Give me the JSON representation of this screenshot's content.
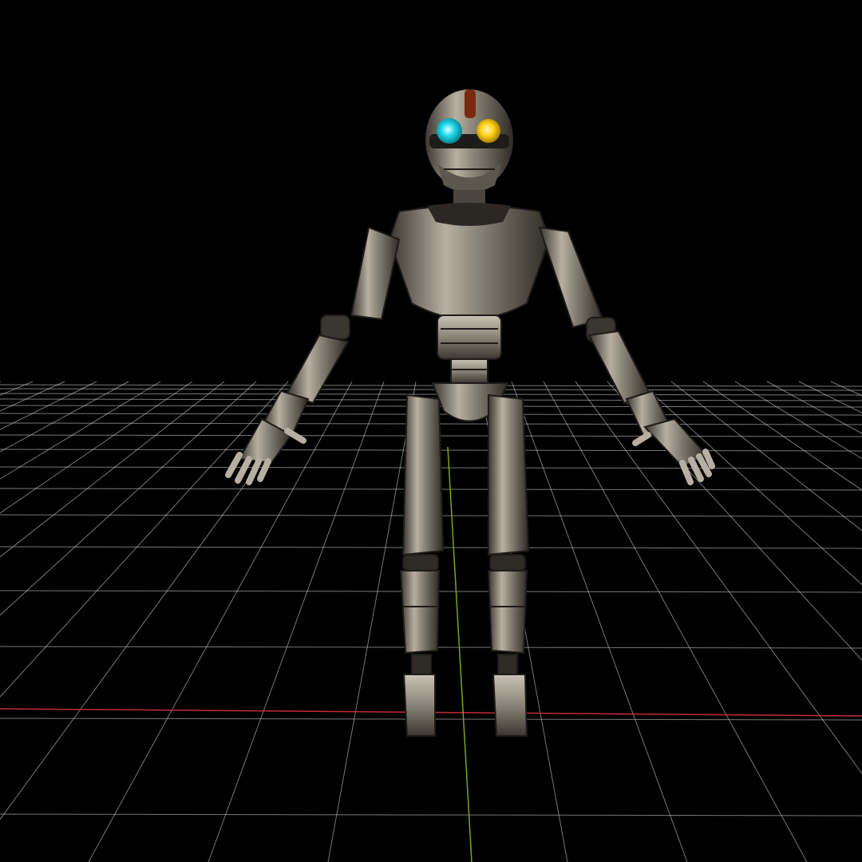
{
  "viewport": {
    "background": "#000000",
    "grid_line_color": "#d9d9d9",
    "x_axis_color": "#c42a37",
    "y_axis_color": "#7fa21a",
    "model": {
      "metal_color": "#8a8478",
      "metal_dark": "#2e2b26",
      "left_eye_color": "#19d6e8",
      "right_eye_color": "#ffd21a",
      "head_stripe_color": "#7a2a12"
    }
  }
}
